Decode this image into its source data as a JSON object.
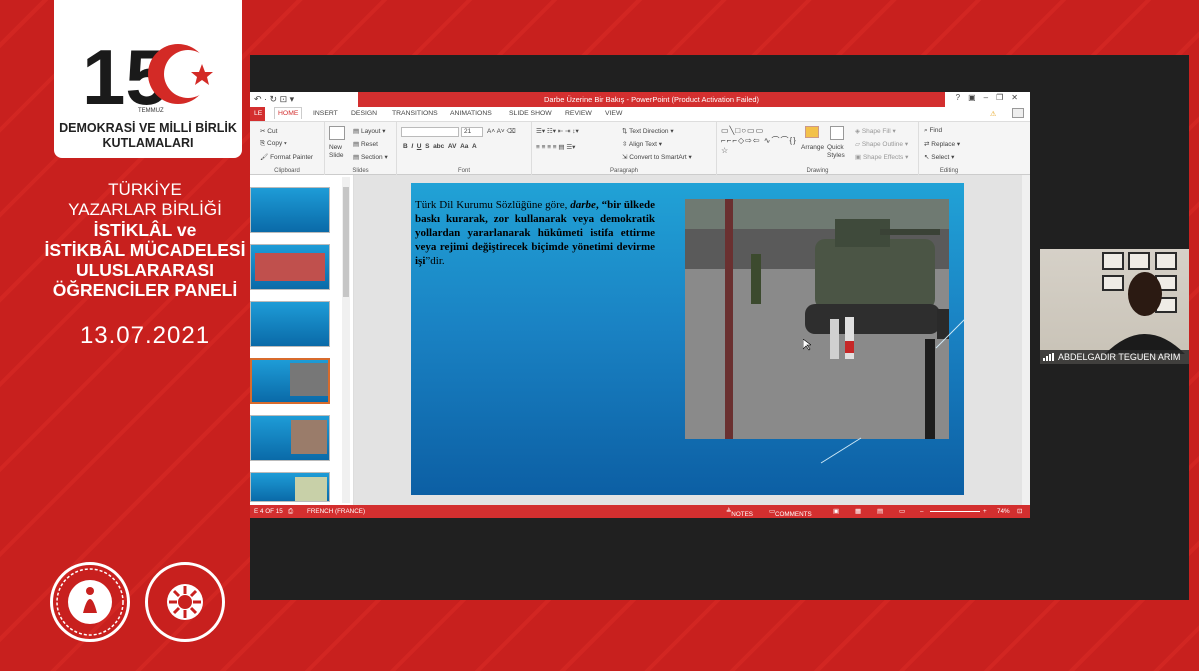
{
  "event": {
    "logo_number": "15",
    "logo_month": "TEMMUZ",
    "logo_caption": "DEMOKRASİ VE MİLLİ BİRLİK KUTLAMALARI",
    "title_lines": [
      "TÜRKİYE",
      "YAZARLAR BİRLİĞİ",
      "İSTİKLÂL ve",
      "İSTİKBÂL MÜCADELESİ",
      "ULUSLARARASI",
      "ÖĞRENCİLER PANELİ"
    ],
    "date": "13.07.2021",
    "emblem_right_text": "TÜRKİYE YAZARLAR BİRLİĞİ"
  },
  "powerpoint": {
    "window_title": "Darbe Üzerine Bir Bakış - PowerPoint (Product Activation Failed)",
    "window_controls": [
      "?",
      "▣",
      "–",
      "❐",
      "✕"
    ],
    "tabs": [
      "LE",
      "HOME",
      "INSERT",
      "DESIGN",
      "TRANSITIONS",
      "ANIMATIONS",
      "SLIDE SHOW",
      "REVIEW",
      "VIEW"
    ],
    "active_tab": "HOME",
    "ribbon": {
      "clipboard": {
        "label": "Clipboard",
        "cut": "Cut",
        "copy": "Copy",
        "format_painter": "Format Painter"
      },
      "slides": {
        "label": "Slides",
        "new_slide": "New Slide",
        "layout": "Layout",
        "reset": "Reset",
        "section": "Section"
      },
      "font": {
        "label": "Font",
        "size": "21",
        "buttons": [
          "B",
          "I",
          "U",
          "S",
          "abc",
          "AV",
          "Aa",
          "A"
        ]
      },
      "paragraph": {
        "label": "Paragraph",
        "text_direction": "Text Direction",
        "align_text": "Align Text",
        "smartart": "Convert to SmartArt"
      },
      "drawing": {
        "label": "Drawing",
        "arrange": "Arrange",
        "quick_styles": "Quick Styles",
        "shape_fill": "Shape Fill",
        "shape_outline": "Shape Outline",
        "shape_effects": "Shape Effects"
      },
      "editing": {
        "label": "Editing",
        "find": "Find",
        "replace": "Replace",
        "select": "Select"
      }
    },
    "slide": {
      "text_plain_1": "Türk Dil Kurumu Sözlüğüne göre, ",
      "text_term": "darbe",
      "text_bold": ", “bir ülkede baskı kurarak, zor kullanarak veya demokratik yollardan yararlanarak hükûmeti istifa ettirme veya rejimi değiştirecek biçimde yönetimi devirme işi",
      "text_end": "”dir."
    },
    "status": {
      "slide_info": "E 4 OF 15",
      "language": "FRENCH (FRANCE)",
      "notes": "NOTES",
      "comments": "COMMENTS",
      "zoom": "74%"
    }
  },
  "participant": {
    "name": "ABDELGADIR TEGUEN ARIM"
  },
  "colors": {
    "brand_red": "#c8201e",
    "ppt_red": "#d32f2f"
  }
}
